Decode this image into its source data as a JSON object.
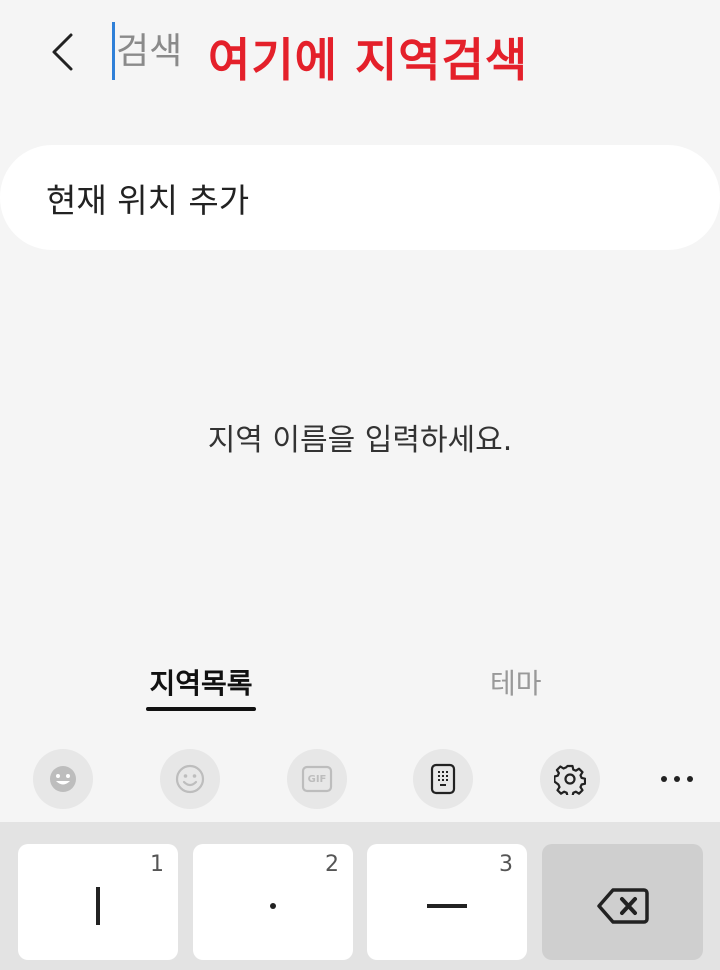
{
  "header": {
    "search_placeholder": "검색",
    "annotation": "여기에 지역검색"
  },
  "current_location": {
    "label": "현재 위치 추가"
  },
  "empty_state": {
    "message": "지역 이름을 입력하세요."
  },
  "tabs": [
    {
      "label": "지역목록",
      "active": true
    },
    {
      "label": "테마",
      "active": false
    }
  ],
  "keyboard_toolbar": {
    "buttons": [
      "emoji-face-icon",
      "smiley-icon",
      "gif-icon",
      "keypad-icon",
      "gear-icon",
      "more-icon"
    ],
    "gif_text": "GIF"
  },
  "keyboard": {
    "keys": [
      {
        "number": "1",
        "symbol": "|"
      },
      {
        "number": "2",
        "symbol": "·"
      },
      {
        "number": "3",
        "symbol": "—"
      }
    ]
  },
  "colors": {
    "annotation": "#e4202a",
    "cursor": "#2f80d8",
    "background": "#f5f5f5"
  }
}
